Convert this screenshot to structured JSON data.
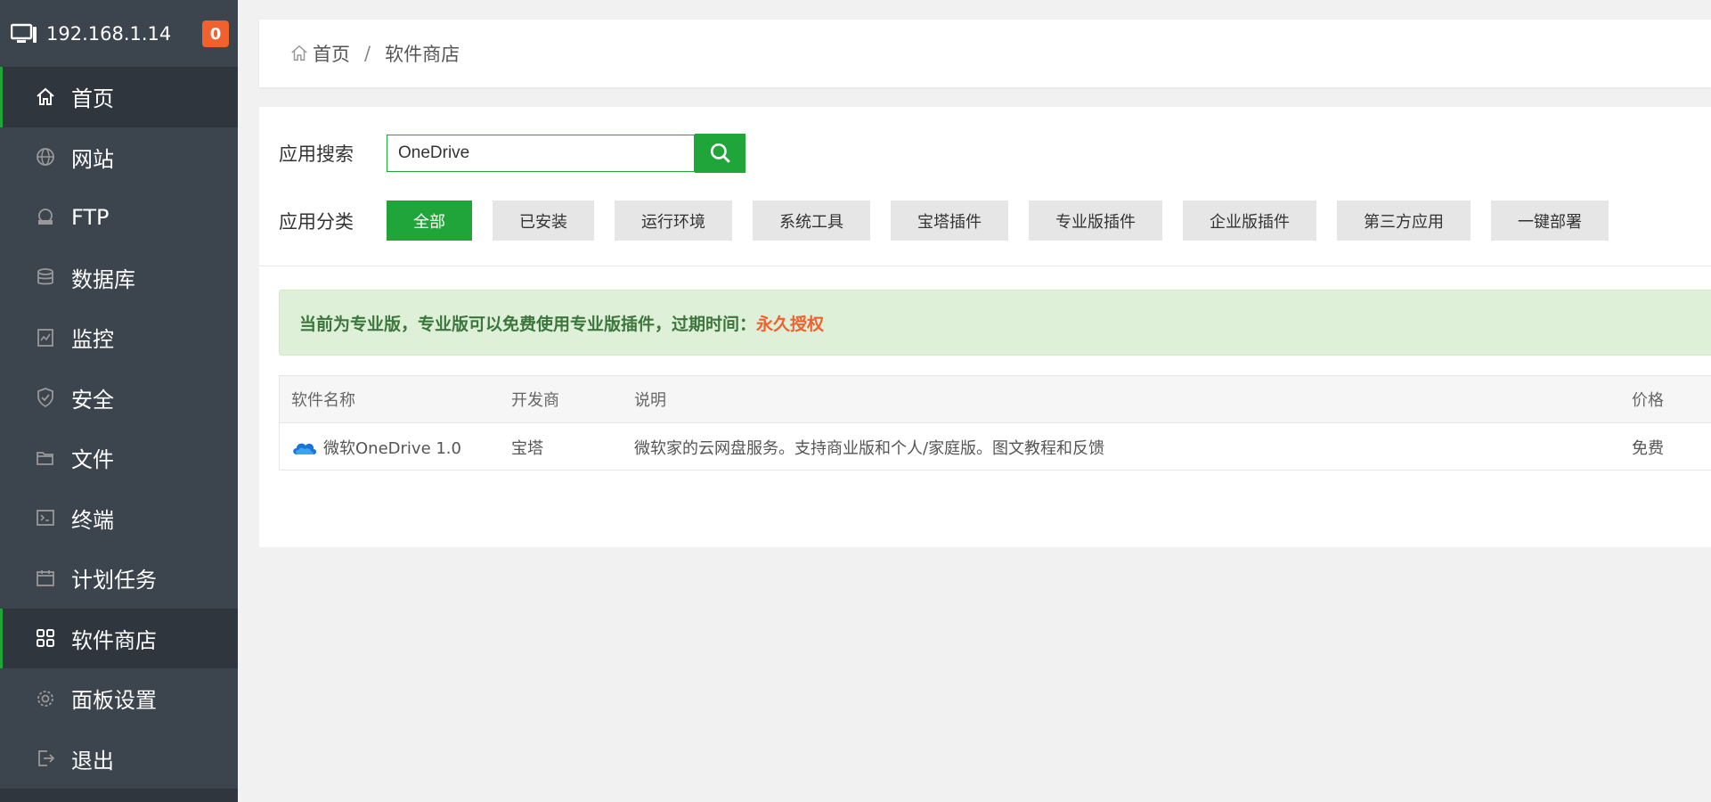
{
  "sidebar": {
    "ip": "192.168.1.14",
    "badge": "0",
    "items": [
      {
        "label": "首页",
        "icon": "home-icon"
      },
      {
        "label": "网站",
        "icon": "globe-icon"
      },
      {
        "label": "FTP",
        "icon": "ftp-icon"
      },
      {
        "label": "数据库",
        "icon": "database-icon"
      },
      {
        "label": "监控",
        "icon": "monitor-icon"
      },
      {
        "label": "安全",
        "icon": "shield-icon"
      },
      {
        "label": "文件",
        "icon": "folder-icon"
      },
      {
        "label": "终端",
        "icon": "terminal-icon"
      },
      {
        "label": "计划任务",
        "icon": "calendar-icon"
      },
      {
        "label": "软件商店",
        "icon": "grid-icon"
      },
      {
        "label": "面板设置",
        "icon": "gear-icon"
      },
      {
        "label": "退出",
        "icon": "logout-icon"
      }
    ]
  },
  "breadcrumb": {
    "home": "首页",
    "sep": "/",
    "current": "软件商店"
  },
  "search": {
    "label": "应用搜索",
    "value": "OneDrive"
  },
  "category": {
    "label": "应用分类",
    "items": [
      "全部",
      "已安装",
      "运行环境",
      "系统工具",
      "宝塔插件",
      "专业版插件",
      "企业版插件",
      "第三方应用",
      "一键部署"
    ],
    "selected": "全部"
  },
  "notice": {
    "text": "当前为专业版，专业版可以免费使用专业版插件，过期时间：",
    "highlight": "永久授权"
  },
  "table": {
    "headers": [
      "软件名称",
      "开发商",
      "说明",
      "价格"
    ],
    "rows": [
      {
        "name": "微软OneDrive 1.0",
        "vendor": "宝塔",
        "desc": "微软家的云网盘服务。支持商业版和个人/家庭版。图文教程和反馈",
        "price": "免费"
      }
    ]
  },
  "colors": {
    "accent": "#20a53a",
    "badge": "#f0612e",
    "sidebar": "#3c444d"
  }
}
